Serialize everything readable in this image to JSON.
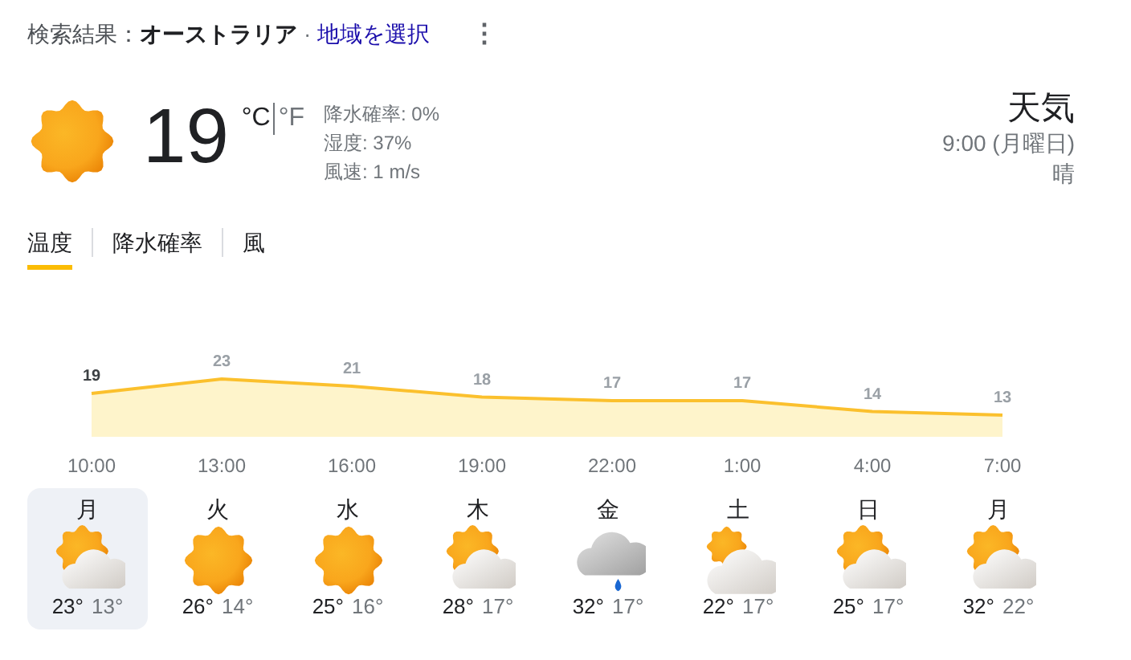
{
  "header": {
    "prefix": "検索結果：",
    "location": "オーストラリア",
    "separator": "·",
    "link": "地域を選択",
    "menu": "⋮"
  },
  "current": {
    "kind": "sun",
    "temperature": "19",
    "units": [
      {
        "label": "°C",
        "selected": true
      },
      {
        "label": "°F",
        "selected": false
      }
    ],
    "details": [
      "降水確率: 0%",
      "湿度: 37%",
      "風速: 1 m/s"
    ]
  },
  "summary": {
    "title": "天気",
    "time": "9:00 (月曜日)",
    "condition": "晴"
  },
  "tabs": [
    {
      "label": "温度",
      "selected": true
    },
    {
      "label": "降水確率",
      "selected": false
    },
    {
      "label": "風",
      "selected": false
    }
  ],
  "chart": {
    "chart_data": {
      "type": "area",
      "categories": [
        "10:00",
        "13:00",
        "16:00",
        "19:00",
        "22:00",
        "1:00",
        "4:00",
        "7:00"
      ],
      "series": [
        {
          "color": "#fbc02d",
          "values": [
            19,
            23,
            21,
            18,
            17,
            17,
            14,
            13
          ]
        }
      ],
      "data_labels": true
    }
  },
  "days": [
    {
      "day": "月",
      "kind": "sun-cloud",
      "high": "23°",
      "low": "13°",
      "selected": true
    },
    {
      "day": "火",
      "kind": "sun",
      "high": "26°",
      "low": "14°",
      "selected": false
    },
    {
      "day": "水",
      "kind": "sun",
      "high": "25°",
      "low": "16°",
      "selected": false
    },
    {
      "day": "木",
      "kind": "sun-cloud",
      "high": "28°",
      "low": "17°",
      "selected": false
    },
    {
      "day": "金",
      "kind": "rain",
      "high": "32°",
      "low": "17°",
      "selected": false
    },
    {
      "day": "土",
      "kind": "cloudy",
      "high": "22°",
      "low": "17°",
      "selected": false
    },
    {
      "day": "日",
      "kind": "sun-cloud",
      "high": "25°",
      "low": "17°",
      "selected": false
    },
    {
      "day": "月",
      "kind": "sun-cloud",
      "high": "32°",
      "low": "22°",
      "selected": false
    }
  ]
}
